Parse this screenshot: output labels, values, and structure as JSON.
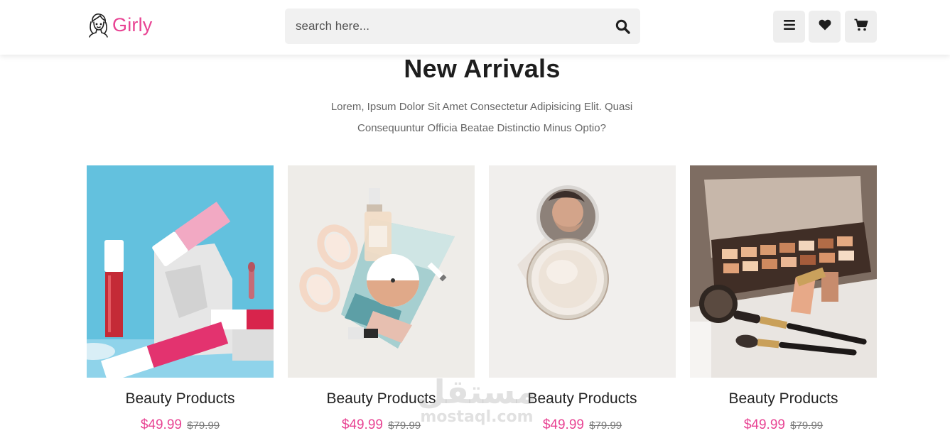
{
  "header": {
    "brand": "Girly",
    "search_placeholder": "search here...",
    "icons": [
      "menu-icon",
      "heart-icon",
      "cart-icon"
    ]
  },
  "section": {
    "title": "New Arrivals",
    "description_line1": "Lorem, Ipsum Dolor Sit Amet Consectetur Adipisicing Elit. Quasi",
    "description_line2": "Consequuntur Officia Beatae Distinctio Minus Optio?"
  },
  "products": [
    {
      "name": "Beauty Products",
      "price": "$49.99",
      "old_price": "$79.99",
      "image": "lipsticks-on-blue"
    },
    {
      "name": "Beauty Products",
      "price": "$49.99",
      "old_price": "$79.99",
      "image": "flatlay-sunglasses-serum"
    },
    {
      "name": "Beauty Products",
      "price": "$49.99",
      "old_price": "$79.99",
      "image": "compact-mirror"
    },
    {
      "name": "Beauty Products",
      "price": "$49.99",
      "old_price": "$79.99",
      "image": "eyeshadow-palette-brushes"
    }
  ],
  "watermark": {
    "arabic": "مستقل",
    "latin": "mostaql.com"
  },
  "colors": {
    "accent": "#e84393",
    "header_bg": "#ffffff",
    "button_bg": "#eeeeee",
    "search_bg": "#f1f1f1",
    "title": "#1e1e1e",
    "muted": "#666666"
  }
}
